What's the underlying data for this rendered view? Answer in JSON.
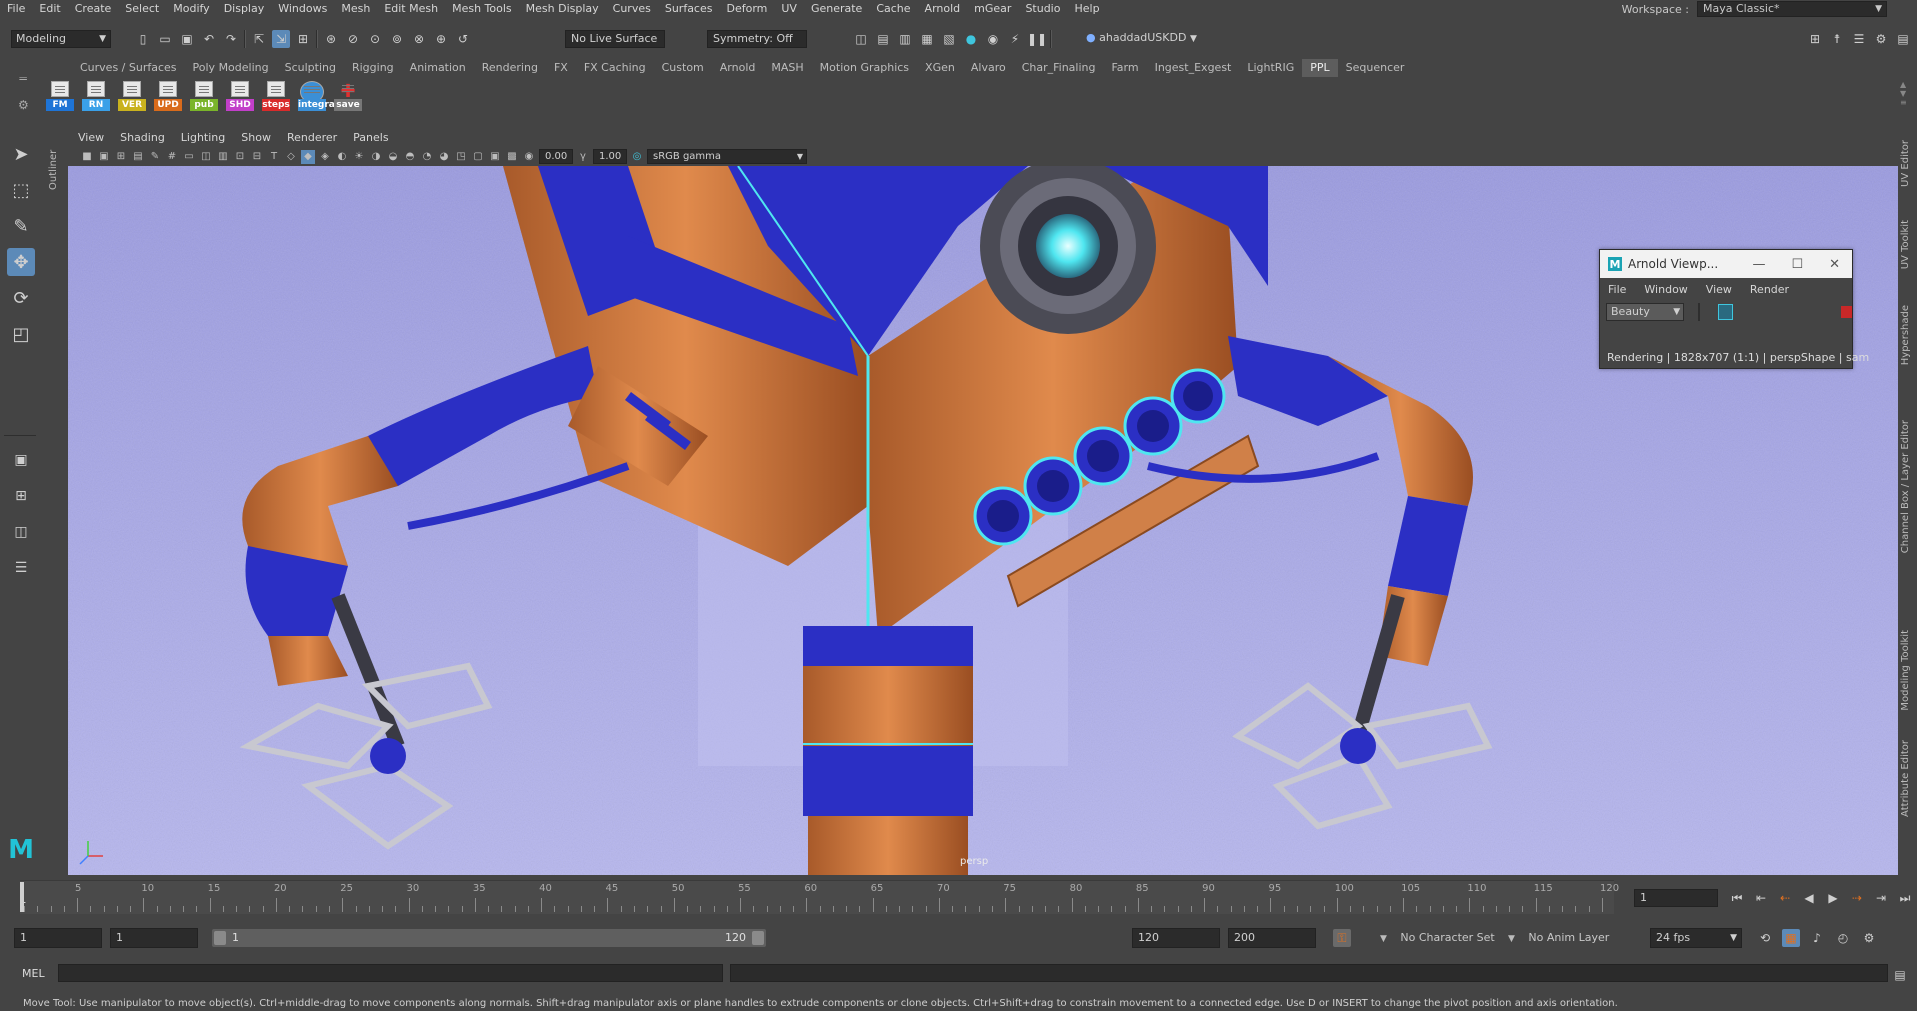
{
  "menubar": {
    "items": [
      "File",
      "Edit",
      "Create",
      "Select",
      "Modify",
      "Display",
      "Windows",
      "Mesh",
      "Edit Mesh",
      "Mesh Tools",
      "Mesh Display",
      "Curves",
      "Surfaces",
      "Deform",
      "UV",
      "Generate",
      "Cache",
      "Arnold",
      "mGear",
      "Studio",
      "Help"
    ],
    "workspace_label": "Workspace :",
    "workspace_value": "Maya Classic*"
  },
  "statusline": {
    "mode": "Modeling",
    "live_surface": "No Live Surface",
    "symmetry": "Symmetry: Off",
    "user": "ahaddadUSKDD"
  },
  "shelf": {
    "tabs": [
      "Curves / Surfaces",
      "Poly Modeling",
      "Sculpting",
      "Rigging",
      "Animation",
      "Rendering",
      "FX",
      "FX Caching",
      "Custom",
      "Arnold",
      "MASH",
      "Motion Graphics",
      "XGen",
      "Alvaro",
      "Char_Finaling",
      "Farm",
      "Ingest_Exgest",
      "LightRIG",
      "PPL",
      "Sequencer"
    ],
    "active_tab": "PPL",
    "buttons": [
      {
        "label": "FM",
        "color": "#1e74d6"
      },
      {
        "label": "RN",
        "color": "#3aa0e8"
      },
      {
        "label": "VER",
        "color": "#c9b21e"
      },
      {
        "label": "UPD",
        "color": "#d96b1b"
      },
      {
        "label": "pub",
        "color": "#7ab52a"
      },
      {
        "label": "SHD",
        "color": "#c23fc9"
      },
      {
        "label": "steps",
        "color": "#d92b2b"
      },
      {
        "label": "integra",
        "color": "#3b8fd6"
      },
      {
        "label": "save",
        "color": "#777777"
      }
    ]
  },
  "outliner_tab": "Outliner",
  "panel": {
    "menus": [
      "View",
      "Shading",
      "Lighting",
      "Show",
      "Renderer",
      "Panels"
    ],
    "exposure": "0.00",
    "gamma": "1.00",
    "color_space": "sRGB gamma",
    "camera_label": "persp"
  },
  "right_tabs": [
    "UV Editor",
    "UV Toolkit",
    "Hypershade",
    "Channel Box / Layer Editor",
    "Modeling Toolkit",
    "Attribute Editor"
  ],
  "arnold_window": {
    "title": "Arnold Viewp...",
    "menus": [
      "File",
      "Window",
      "View",
      "Render"
    ],
    "aov": "Beauty",
    "status": "Rendering | 1828x707 (1:1) | perspShape | sam"
  },
  "timeline": {
    "ticks": [
      "5",
      "10",
      "15",
      "20",
      "25",
      "30",
      "35",
      "40",
      "45",
      "50",
      "55",
      "60",
      "65",
      "70",
      "75",
      "80",
      "85",
      "90",
      "95",
      "100",
      "105",
      "110",
      "115",
      "120"
    ],
    "start_label": "1",
    "current_frame": "1"
  },
  "range": {
    "start": "1",
    "playback_start": "1",
    "slider_start": "1",
    "slider_end": "120",
    "playback_end": "120",
    "end": "200",
    "character_set": "No Character Set",
    "anim_layer": "No Anim Layer",
    "fps": "24 fps"
  },
  "command": {
    "language": "MEL"
  },
  "help_text": "Move Tool: Use manipulator to move object(s). Ctrl+middle-drag to move components along normals. Shift+drag manipulator axis or plane handles to extrude components or clone objects. Ctrl+Shift+drag to constrain movement to a connected edge. Use D or INSERT to change the pivot position and axis orientation.",
  "colors": {
    "ui_bg": "#444444",
    "field_bg": "#2b2b2b",
    "viewport_bg": "#a9a9e6",
    "robot_blue": "#2b2fc4",
    "robot_orange": "#d08048",
    "cyan_glow": "#4fe6f0"
  }
}
